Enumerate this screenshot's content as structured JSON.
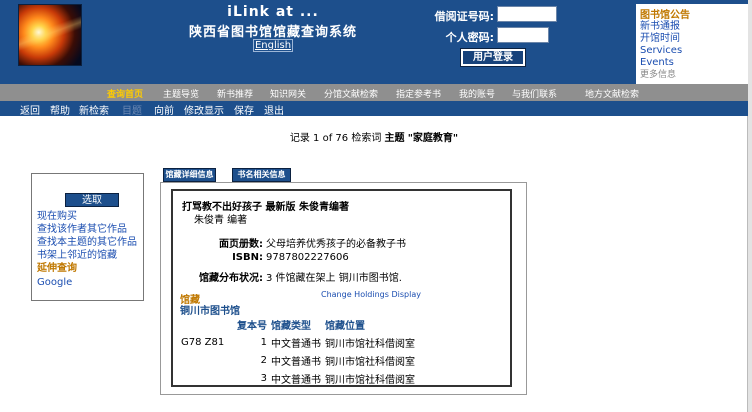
{
  "header": {
    "brand_line1": "iLink at ...",
    "brand_line2": "陕西省图书馆馆藏查询系统",
    "lang_link": "English",
    "login": {
      "card_label": "借阅证号码:",
      "password_label": "个人密码:",
      "card_value": "",
      "password_value": "",
      "button": "用户登录"
    }
  },
  "notice": {
    "title": "图书馆公告",
    "items": [
      "新书通报",
      "开馆时间",
      "Services",
      "Events"
    ],
    "more": "更多信息"
  },
  "nav_main": [
    "查询首页",
    "主题导览",
    "新书推荐",
    "知识网关",
    "分馆文献检索",
    "指定参考书",
    "我的账号",
    "与我们联系",
    "地方文献检索"
  ],
  "nav_sub": [
    "返回",
    "帮助",
    "新检索",
    "目题",
    "向前",
    "修改显示",
    "保存",
    "退出"
  ],
  "record": {
    "summary_prefix": "记录 1 of 76 检索词",
    "summary_field": "主题",
    "summary_term": "\"家庭教育\""
  },
  "sidebar": {
    "button": "选取",
    "links": [
      "现在购买",
      "查找该作者其它作品",
      "查找本主题的其它作品",
      "书架上邻近的馆藏"
    ],
    "subheading": "延伸查询",
    "extra_links": [
      "Google"
    ]
  },
  "tabs": [
    "馆藏详细信息",
    "书名相关信息"
  ],
  "detail": {
    "title": "打骂教不出好孩子  最新版  朱俊青编著",
    "author": "朱俊青  编著",
    "fields": [
      {
        "key": "面页册数:",
        "value": "父母培养优秀孩子的必备教子书"
      },
      {
        "key": "ISBN:",
        "value": "9787802227606"
      },
      {
        "key": "馆藏分布状况:",
        "value": "3 件馆藏在架上  铜川市图书馆."
      }
    ],
    "holdings_link": "Change Holdings Display",
    "holdings_heading": "馆藏",
    "library": "铜川市图书馆",
    "table_headers": [
      "",
      "复本号",
      "馆藏类型",
      "馆藏位置"
    ],
    "rows": [
      {
        "call": "G78 Z81",
        "copy": "1",
        "type": "中文普通书",
        "location": "铜川市馆社科借阅室"
      },
      {
        "call": "",
        "copy": "2",
        "type": "中文普通书",
        "location": "铜川市馆社科借阅室"
      },
      {
        "call": "",
        "copy": "3",
        "type": "中文普通书",
        "location": "铜川市馆社科借阅室"
      }
    ]
  }
}
